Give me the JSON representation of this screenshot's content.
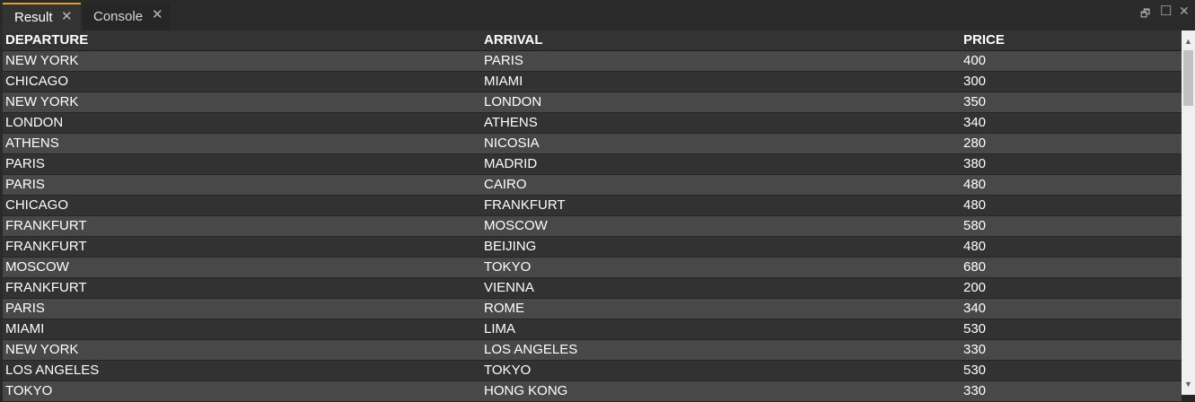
{
  "tabs": [
    {
      "label": "Result",
      "close": "✕"
    },
    {
      "label": "Console",
      "close": "✕"
    }
  ],
  "window_controls": {
    "restore": "🗗",
    "maximize": "☐",
    "close": "✕"
  },
  "colors": {
    "active_tab_accent": "#e0a020",
    "row_odd": "#484848",
    "row_even": "#323232"
  },
  "table": {
    "headers": [
      "DEPARTURE",
      "ARRIVAL",
      "PRICE"
    ],
    "rows": [
      [
        "NEW YORK",
        "PARIS",
        "400"
      ],
      [
        "CHICAGO",
        "MIAMI",
        "300"
      ],
      [
        "NEW YORK",
        "LONDON",
        "350"
      ],
      [
        "LONDON",
        "ATHENS",
        "340"
      ],
      [
        "ATHENS",
        "NICOSIA",
        "280"
      ],
      [
        "PARIS",
        "MADRID",
        "380"
      ],
      [
        "PARIS",
        "CAIRO",
        "480"
      ],
      [
        "CHICAGO",
        "FRANKFURT",
        "480"
      ],
      [
        "FRANKFURT",
        "MOSCOW",
        "580"
      ],
      [
        "FRANKFURT",
        "BEIJING",
        "480"
      ],
      [
        "MOSCOW",
        "TOKYO",
        "680"
      ],
      [
        "FRANKFURT",
        "VIENNA",
        "200"
      ],
      [
        "PARIS",
        "ROME",
        "340"
      ],
      [
        "MIAMI",
        "LIMA",
        "530"
      ],
      [
        "NEW YORK",
        "LOS ANGELES",
        "330"
      ],
      [
        "LOS ANGELES",
        "TOKYO",
        "530"
      ],
      [
        "TOKYO",
        "HONG KONG",
        "330"
      ]
    ]
  },
  "scrollbar": {
    "up": "▲",
    "down": "▼"
  }
}
